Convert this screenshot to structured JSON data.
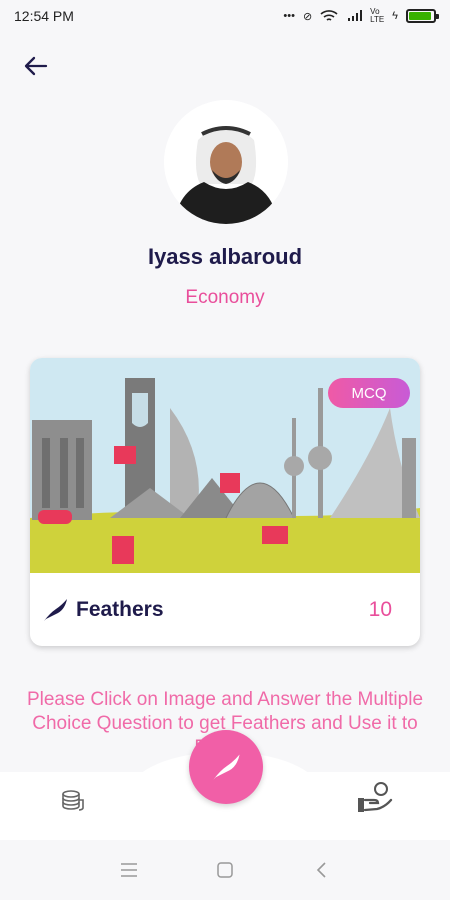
{
  "status": {
    "time": "12:54 PM",
    "network": "Vo LTE"
  },
  "profile": {
    "name": "Iyass albaroud",
    "category": "Economy"
  },
  "card": {
    "badge": "MCQ",
    "label": "Feathers",
    "count": "10"
  },
  "instructions": "Please Click on Image and Answer the Multiple Choice Question to get Feathers and Use it to Donate",
  "icons": {
    "back": "back-arrow-icon",
    "feather": "feather-icon",
    "coins": "coins-icon",
    "donate": "donate-hand-icon"
  },
  "colors": {
    "accent": "#e94e9b",
    "title": "#1f1b4b",
    "fab": "#f15fa7"
  }
}
